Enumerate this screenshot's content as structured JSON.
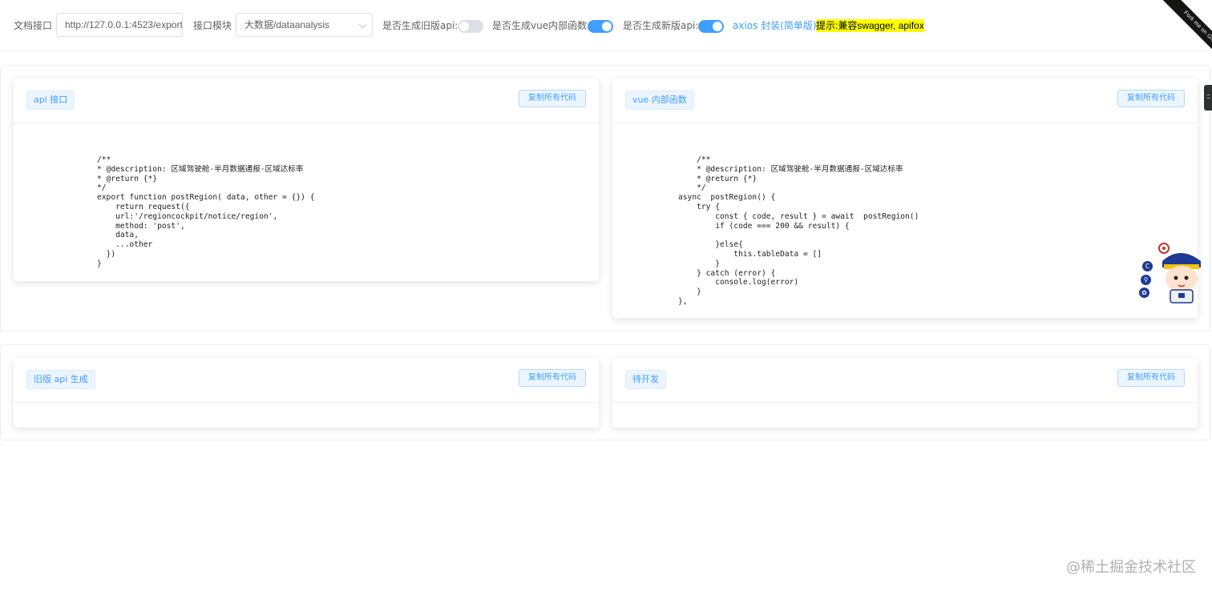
{
  "toolbar": {
    "doc_label": "文档接口",
    "doc_url": "http://127.0.0.1:4523/export",
    "module_label": "接口模块",
    "module_value": "大数据/dataanalysis",
    "old_api_label": "是否生成旧版api:",
    "old_api_enabled": false,
    "vue_fn_label": "是否生成vue内部函数:",
    "vue_fn_enabled": true,
    "new_api_label": "是否生成新版api:",
    "new_api_enabled": true,
    "axios_link": "axios 封装(简单版)",
    "hint": "提示:兼容swagger, apifox"
  },
  "ribbon": {
    "text": "Fork me on GitHub"
  },
  "cards": {
    "api": {
      "tag": "api 接口",
      "copy_label": "复制所有代码",
      "code": "/**\n* @description: 区域驾驶舱-半月数据通报-区域达标率\n* @return {*}\n*/\nexport function postRegion( data, other = {}) {\n    return request({\n    url:'/regioncockpit/notice/region',\n    method: 'post',\n    data,\n    ...other\n  })\n}"
    },
    "vue": {
      "tag": "vue 内部函数",
      "copy_label": "复制所有代码",
      "code": "    /**\n    * @description: 区域驾驶舱-半月数据通报-区域达标率\n    * @return {*}\n    */\nasync  postRegion() {\n    try {\n        const { code, result } = await  postRegion()\n        if (code === 200 && result) {\n\n        }else{\n            this.tableData = []\n        }\n    } catch (error) {\n        console.log(error)\n    }\n},"
    },
    "old_api": {
      "tag": "旧版 api 生成",
      "copy_label": "复制所有代码"
    },
    "pending": {
      "tag": "待开发",
      "copy_label": "复制所有代码"
    }
  },
  "side_icons": [
    "copyright-icon",
    "share-icon",
    "settings-icon"
  ],
  "watermark": "@稀土掘金技术社区"
}
